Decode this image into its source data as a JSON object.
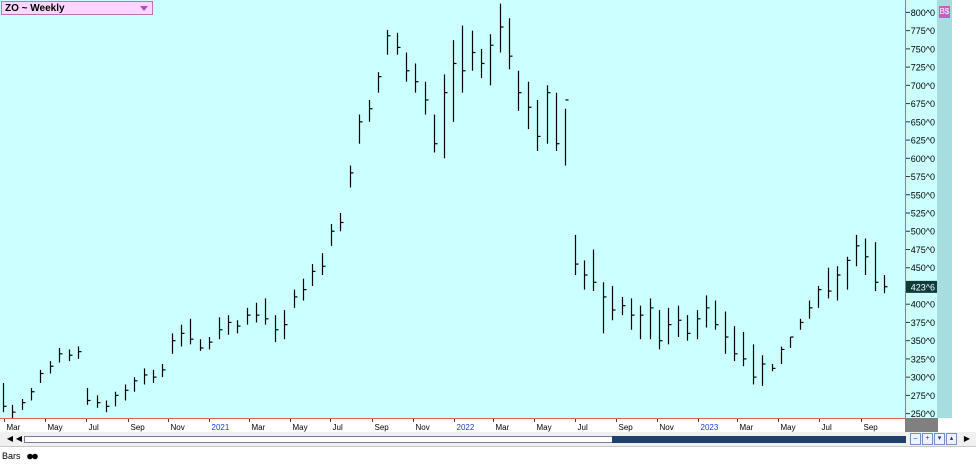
{
  "window": {
    "title": "ZO ~ Weekly"
  },
  "price_axis": {
    "labels": [
      "800^0",
      "775^0",
      "750^0",
      "725^0",
      "700^0",
      "675^0",
      "650^0",
      "625^0",
      "600^0",
      "575^0",
      "550^0",
      "525^0",
      "500^0",
      "475^0",
      "450^0",
      "425^0",
      "400^0",
      "375^0",
      "350^0",
      "325^0",
      "300^0",
      "275^0",
      "250^0"
    ],
    "last_price_label": "423^6"
  },
  "time_axis": {
    "labels": [
      "Mar",
      "May",
      "Jul",
      "Sep",
      "Nov",
      "2021",
      "Mar",
      "May",
      "Jul",
      "Sep",
      "Nov",
      "2022",
      "Mar",
      "May",
      "Jul",
      "Sep",
      "Nov",
      "2023",
      "Mar",
      "May",
      "Jul",
      "Sep"
    ]
  },
  "toolbar": {
    "bars_tab_label": "Bars",
    "right_button_label": "B$"
  },
  "colors": {
    "plot_bg": "#ccffff",
    "bars": "#000000",
    "year_label": "#1a3fc8",
    "last_price_bg": "#0d3b3b"
  },
  "chart_data": {
    "type": "ohlc",
    "title": "ZO ~ Weekly",
    "ylim": [
      244,
      817
    ],
    "y_tick_values": [
      800,
      775,
      750,
      725,
      700,
      675,
      650,
      625,
      600,
      575,
      550,
      525,
      500,
      475,
      450,
      425,
      400,
      375,
      350,
      325,
      300,
      275,
      250
    ],
    "x_start": "2020-02-28",
    "x_end": "2023-10-06",
    "x": [
      "2020-02-28",
      "2020-03-13",
      "2020-03-27",
      "2020-04-10",
      "2020-04-24",
      "2020-05-08",
      "2020-05-22",
      "2020-06-05",
      "2020-06-19",
      "2020-07-03",
      "2020-07-17",
      "2020-07-31",
      "2020-08-14",
      "2020-08-28",
      "2020-09-11",
      "2020-09-25",
      "2020-10-09",
      "2020-10-23",
      "2020-11-06",
      "2020-11-20",
      "2020-12-04",
      "2020-12-18",
      "2021-01-01",
      "2021-01-15",
      "2021-01-29",
      "2021-02-12",
      "2021-02-26",
      "2021-03-12",
      "2021-03-26",
      "2021-04-09",
      "2021-04-23",
      "2021-05-07",
      "2021-05-21",
      "2021-06-04",
      "2021-06-18",
      "2021-07-02",
      "2021-07-16",
      "2021-07-30",
      "2021-08-13",
      "2021-08-27",
      "2021-09-10",
      "2021-09-24",
      "2021-10-08",
      "2021-10-22",
      "2021-11-05",
      "2021-11-19",
      "2021-12-03",
      "2021-12-17",
      "2021-12-31",
      "2022-01-14",
      "2022-01-28",
      "2022-02-11",
      "2022-02-25",
      "2022-03-11",
      "2022-03-25",
      "2022-04-08",
      "2022-04-22",
      "2022-05-06",
      "2022-05-20",
      "2022-06-03",
      "2022-06-17",
      "2022-07-01",
      "2022-07-15",
      "2022-07-29",
      "2022-08-12",
      "2022-08-26",
      "2022-09-09",
      "2022-09-23",
      "2022-10-07",
      "2022-10-21",
      "2022-11-04",
      "2022-11-18",
      "2022-12-02",
      "2022-12-16",
      "2022-12-30",
      "2023-01-13",
      "2023-01-27",
      "2023-02-10",
      "2023-02-24",
      "2023-03-10",
      "2023-03-24",
      "2023-04-07",
      "2023-04-21",
      "2023-05-05",
      "2023-05-19",
      "2023-06-02",
      "2023-06-16",
      "2023-06-30",
      "2023-07-14",
      "2023-07-28",
      "2023-08-11",
      "2023-08-25",
      "2023-09-08",
      "2023-09-22",
      "2023-10-06"
    ],
    "high": [
      292,
      262,
      270,
      285,
      310,
      322,
      340,
      338,
      342,
      285,
      275,
      268,
      280,
      290,
      300,
      312,
      310,
      318,
      360,
      372,
      380,
      352,
      355,
      382,
      385,
      378,
      395,
      402,
      408,
      385,
      392,
      420,
      435,
      455,
      470,
      510,
      525,
      590,
      660,
      680,
      718,
      776,
      772,
      745,
      730,
      705,
      660,
      715,
      762,
      782,
      775,
      750,
      770,
      812,
      792,
      720,
      705,
      680,
      700,
      690,
      668,
      495,
      460,
      475,
      430,
      425,
      410,
      408,
      398,
      408,
      392,
      395,
      398,
      385,
      392,
      412,
      405,
      390,
      370,
      362,
      345,
      330,
      318,
      342,
      355,
      380,
      405,
      425,
      450,
      452,
      465,
      495,
      490,
      485,
      440
    ],
    "low": [
      252,
      244,
      255,
      268,
      292,
      305,
      320,
      322,
      325,
      262,
      258,
      252,
      260,
      268,
      280,
      290,
      292,
      300,
      332,
      342,
      345,
      336,
      338,
      352,
      358,
      360,
      372,
      375,
      372,
      348,
      352,
      395,
      405,
      425,
      440,
      480,
      500,
      560,
      620,
      650,
      690,
      742,
      742,
      705,
      690,
      660,
      608,
      600,
      650,
      690,
      720,
      710,
      700,
      745,
      722,
      665,
      640,
      610,
      620,
      610,
      590,
      440,
      420,
      418,
      360,
      378,
      385,
      365,
      352,
      352,
      338,
      345,
      355,
      350,
      352,
      368,
      365,
      332,
      322,
      315,
      290,
      288,
      308,
      318,
      340,
      365,
      380,
      395,
      408,
      405,
      420,
      452,
      440,
      418,
      415
    ],
    "close": [
      260,
      252,
      265,
      280,
      305,
      315,
      332,
      330,
      335,
      268,
      265,
      260,
      275,
      282,
      295,
      303,
      300,
      310,
      350,
      360,
      352,
      340,
      348,
      365,
      375,
      370,
      385,
      385,
      380,
      365,
      372,
      410,
      420,
      445,
      452,
      500,
      512,
      580,
      650,
      668,
      712,
      768,
      752,
      720,
      705,
      680,
      620,
      690,
      730,
      720,
      745,
      730,
      755,
      780,
      740,
      690,
      670,
      630,
      690,
      620,
      680,
      455,
      440,
      430,
      410,
      392,
      398,
      385,
      385,
      395,
      350,
      372,
      378,
      360,
      380,
      395,
      372,
      355,
      332,
      325,
      300,
      318,
      312,
      338,
      355,
      375,
      395,
      420,
      418,
      440,
      460,
      480,
      465,
      430,
      424
    ],
    "last_value": 423.75
  }
}
